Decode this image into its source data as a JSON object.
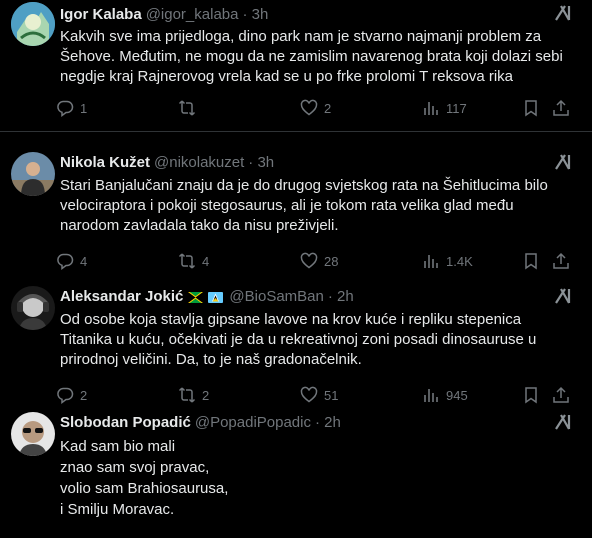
{
  "tweets": [
    {
      "name": "Igor Kalaba",
      "handle": "@igor_kalaba",
      "time": "· 3h",
      "text": "Kakvih sve ima prijedloga, dino park nam je stvarno najmanji problem za Šehove. Međutim, ne mogu da ne zamislim navarenog brata koji dolazi sebi negdje kraj Rajnerovog vrela kad se u po frke prolomi T reksova rika",
      "replies": "1",
      "retweets": "",
      "likes": "2",
      "views": "117"
    },
    {
      "name": "Nikola Kužet",
      "handle": "@nikolakuzet",
      "time": "· 3h",
      "text": "Stari Banjalučani znaju da je do drugog svjetskog rata na Šehitlucima bilo velociraptora i pokoji stegosaurus, ali je tokom rata velika glad među narodom zavladala tako da nisu preživjeli.",
      "replies": "4",
      "retweets": "4",
      "likes": "28",
      "views": "1.4K"
    },
    {
      "name": "Aleksandar Jokić",
      "handle": "@BioSamBan",
      "time": "· 2h",
      "text": "Od osobe koja stavlja gipsane lavove na krov kuće i repliku stepenica Titanika u kuću, očekivati je da u rekreativnoj zoni posadi dinosauruse u prirodnoj veličini. Da, to je naš gradonačelnik.",
      "replies": "2",
      "retweets": "2",
      "likes": "51",
      "views": "945"
    },
    {
      "name": "Slobodan Popadić",
      "handle": "@PopadiPopadic",
      "time": "· 2h",
      "text": "Kad sam bio mali\nznao sam svoj pravac,\nvolio sam Brahiosaurusa,\ni Smilju Moravac."
    }
  ],
  "colors": {
    "bg": "#000000",
    "text": "#e7e9ea",
    "muted": "#71767b",
    "divider": "#2f3336"
  },
  "icons": [
    "reply-icon",
    "retweet-icon",
    "like-icon",
    "views-icon",
    "bookmark-icon",
    "share-icon",
    "grok-icon"
  ]
}
